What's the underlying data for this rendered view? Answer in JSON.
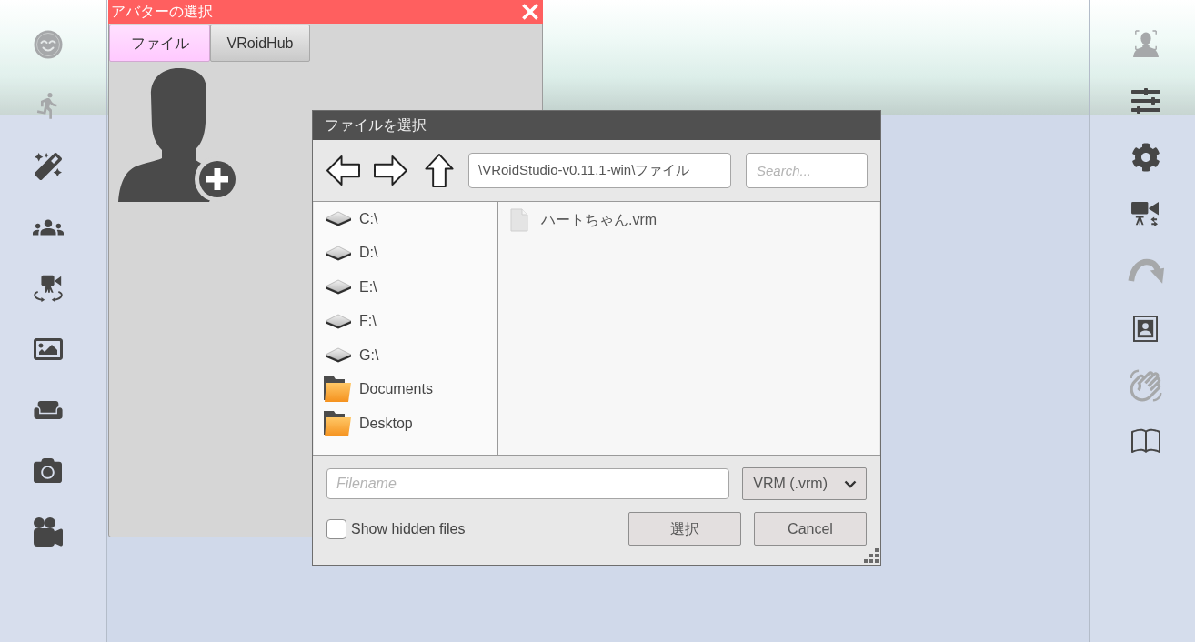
{
  "left_toolbar": {
    "items": [
      {
        "disabled": true
      },
      {
        "disabled": true
      },
      {
        "disabled": false
      },
      {
        "disabled": false
      },
      {
        "disabled": false
      },
      {
        "disabled": false
      },
      {
        "disabled": false
      },
      {
        "disabled": false
      },
      {
        "disabled": false
      }
    ]
  },
  "avatar_dialog": {
    "title": "アバターの選択",
    "tabs": [
      {
        "label": "ファイル",
        "selected": true
      },
      {
        "label": "VRoidHub",
        "selected": false
      }
    ]
  },
  "file_dialog": {
    "title": "ファイルを選択",
    "path": "\\VRoidStudio-v0.11.1-win\\ファイル",
    "search": {
      "placeholder": "Search..."
    },
    "places": [
      {
        "kind": "drive",
        "label": "C:\\"
      },
      {
        "kind": "drive",
        "label": "D:\\"
      },
      {
        "kind": "drive",
        "label": "E:\\"
      },
      {
        "kind": "drive",
        "label": "F:\\"
      },
      {
        "kind": "drive",
        "label": "G:\\"
      },
      {
        "kind": "folder",
        "label": "Documents"
      },
      {
        "kind": "folder",
        "label": "Desktop"
      }
    ],
    "files": [
      {
        "name": "ハートちゃん.vrm"
      }
    ],
    "filename": {
      "placeholder": "Filename"
    },
    "file_type": {
      "value": "VRM (.vrm)"
    },
    "show_hidden": {
      "label": "Show hidden files",
      "checked": false
    },
    "buttons": [
      {
        "label": "選択"
      },
      {
        "label": "Cancel"
      }
    ]
  },
  "right_toolbar": {
    "items": [
      {
        "disabled": true
      },
      {
        "disabled": false
      },
      {
        "disabled": false
      },
      {
        "disabled": false
      },
      {
        "disabled": true
      },
      {
        "disabled": false
      },
      {
        "disabled": true
      },
      {
        "disabled": false
      }
    ]
  }
}
